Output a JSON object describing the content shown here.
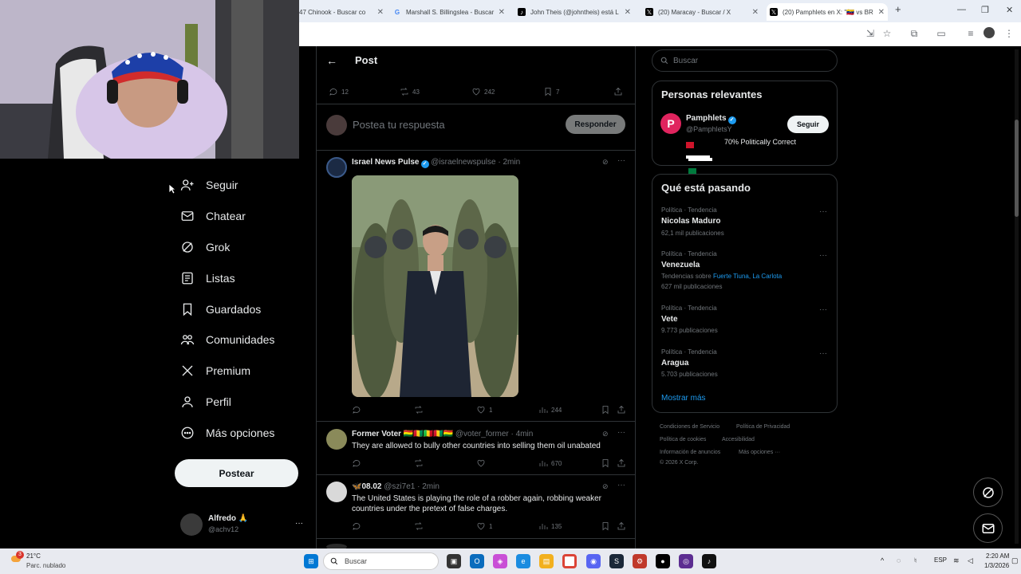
{
  "browser": {
    "tabs": [
      {
        "label": "47 Chinook - Buscar co",
        "icon": "google-icon"
      },
      {
        "label": "Marshall S. Billingslea - Buscar",
        "icon": "google-icon"
      },
      {
        "label": "John Theis (@johntheis) está L",
        "icon": "tiktok-icon"
      },
      {
        "label": "(20) Maracay - Buscar / X",
        "icon": "x-icon"
      },
      {
        "label": "(20) Pamphlets en X: \"🇻🇪 vs BR",
        "icon": "x-icon",
        "active": true
      }
    ],
    "new_tab": "+",
    "min": "—",
    "max": "❐",
    "close": "✕"
  },
  "sidebar": {
    "items": [
      {
        "label": "Seguir",
        "icon": "follow-icon"
      },
      {
        "label": "Chatear",
        "icon": "mail-icon"
      },
      {
        "label": "Grok",
        "icon": "grok-icon"
      },
      {
        "label": "Listas",
        "icon": "list-icon"
      },
      {
        "label": "Guardados",
        "icon": "bookmark-icon"
      },
      {
        "label": "Comunidades",
        "icon": "communities-icon"
      },
      {
        "label": "Premium",
        "icon": "x-logo-icon"
      },
      {
        "label": "Perfil",
        "icon": "profile-icon"
      },
      {
        "label": "Más opciones",
        "icon": "more-icon"
      }
    ],
    "post_button": "Postear",
    "account": {
      "name": "Alfredo 🙏",
      "handle": "@achv12",
      "more": "···"
    }
  },
  "main": {
    "header": {
      "back": "←",
      "title": "Post"
    },
    "stats": {
      "replies": "12",
      "reposts": "43",
      "likes": "242",
      "bookmarks": "7"
    },
    "reply_placeholder": "Postea tu respuesta",
    "reply_button": "Responder",
    "tweets": [
      {
        "name": "Israel News Pulse",
        "handle": "@israelnewspulse · 2min",
        "text": "",
        "views": "244",
        "likes": "1",
        "replies": "",
        "reposts": ""
      },
      {
        "name": "Former Voter 🇧🇴🇬🇳🇲🇱🇬🇳🇧🇴",
        "handle": "@voter_former · 4min",
        "text": "They are allowed to bully other countries into selling them oil unabated",
        "views": "670",
        "likes": "",
        "replies": "",
        "reposts": ""
      },
      {
        "name": "🦋08.02",
        "handle": "@szi7e1 · 2min",
        "text": "The United States is playing the role of a robber again, robbing weaker countries under the pretext of false charges.",
        "views": "135",
        "likes": "1",
        "replies": "",
        "reposts": ""
      }
    ]
  },
  "right": {
    "search_placeholder": "Buscar",
    "relevant": {
      "title": "Personas relevantes",
      "name": "Pamphlets",
      "handle": "@PamphletsY",
      "bio": "70% Politically Correct",
      "follow": "Seguir"
    },
    "trending": {
      "title": "Qué está pasando",
      "items": [
        {
          "meta": "Política · Tendencia",
          "name": "Nicolas Maduro",
          "count": "62,1 mil publicaciones"
        },
        {
          "meta": "Política · Tendencia",
          "name": "Venezuela",
          "related_prefix": "Tendencias sobre",
          "related": "Fuerte Tiuna, La Carlota",
          "count": "627 mil publicaciones"
        },
        {
          "meta": "Política · Tendencia",
          "name": "Vete",
          "count": "9.773 publicaciones"
        },
        {
          "meta": "Política · Tendencia",
          "name": "Aragua",
          "count": "5.703 publicaciones"
        }
      ],
      "show_more": "Mostrar más"
    },
    "footer": {
      "links": [
        "Condiciones de Servicio",
        "Política de Privacidad",
        "Política de cookies",
        "Accesibilidad",
        "Información de anuncios",
        "Más opciones ···"
      ],
      "copyright": "© 2026 X Corp."
    }
  },
  "taskbar": {
    "weather_temp": "21°C",
    "weather_desc": "Parc. nublado",
    "weather_badge": "3",
    "search": "Buscar",
    "lang": "ESP",
    "time": "2:20 AM",
    "date": "1/3/2026"
  },
  "colors": {
    "accent": "#1d9bf0",
    "bg": "#000000",
    "border": "#2f3336",
    "muted": "#71767b"
  }
}
